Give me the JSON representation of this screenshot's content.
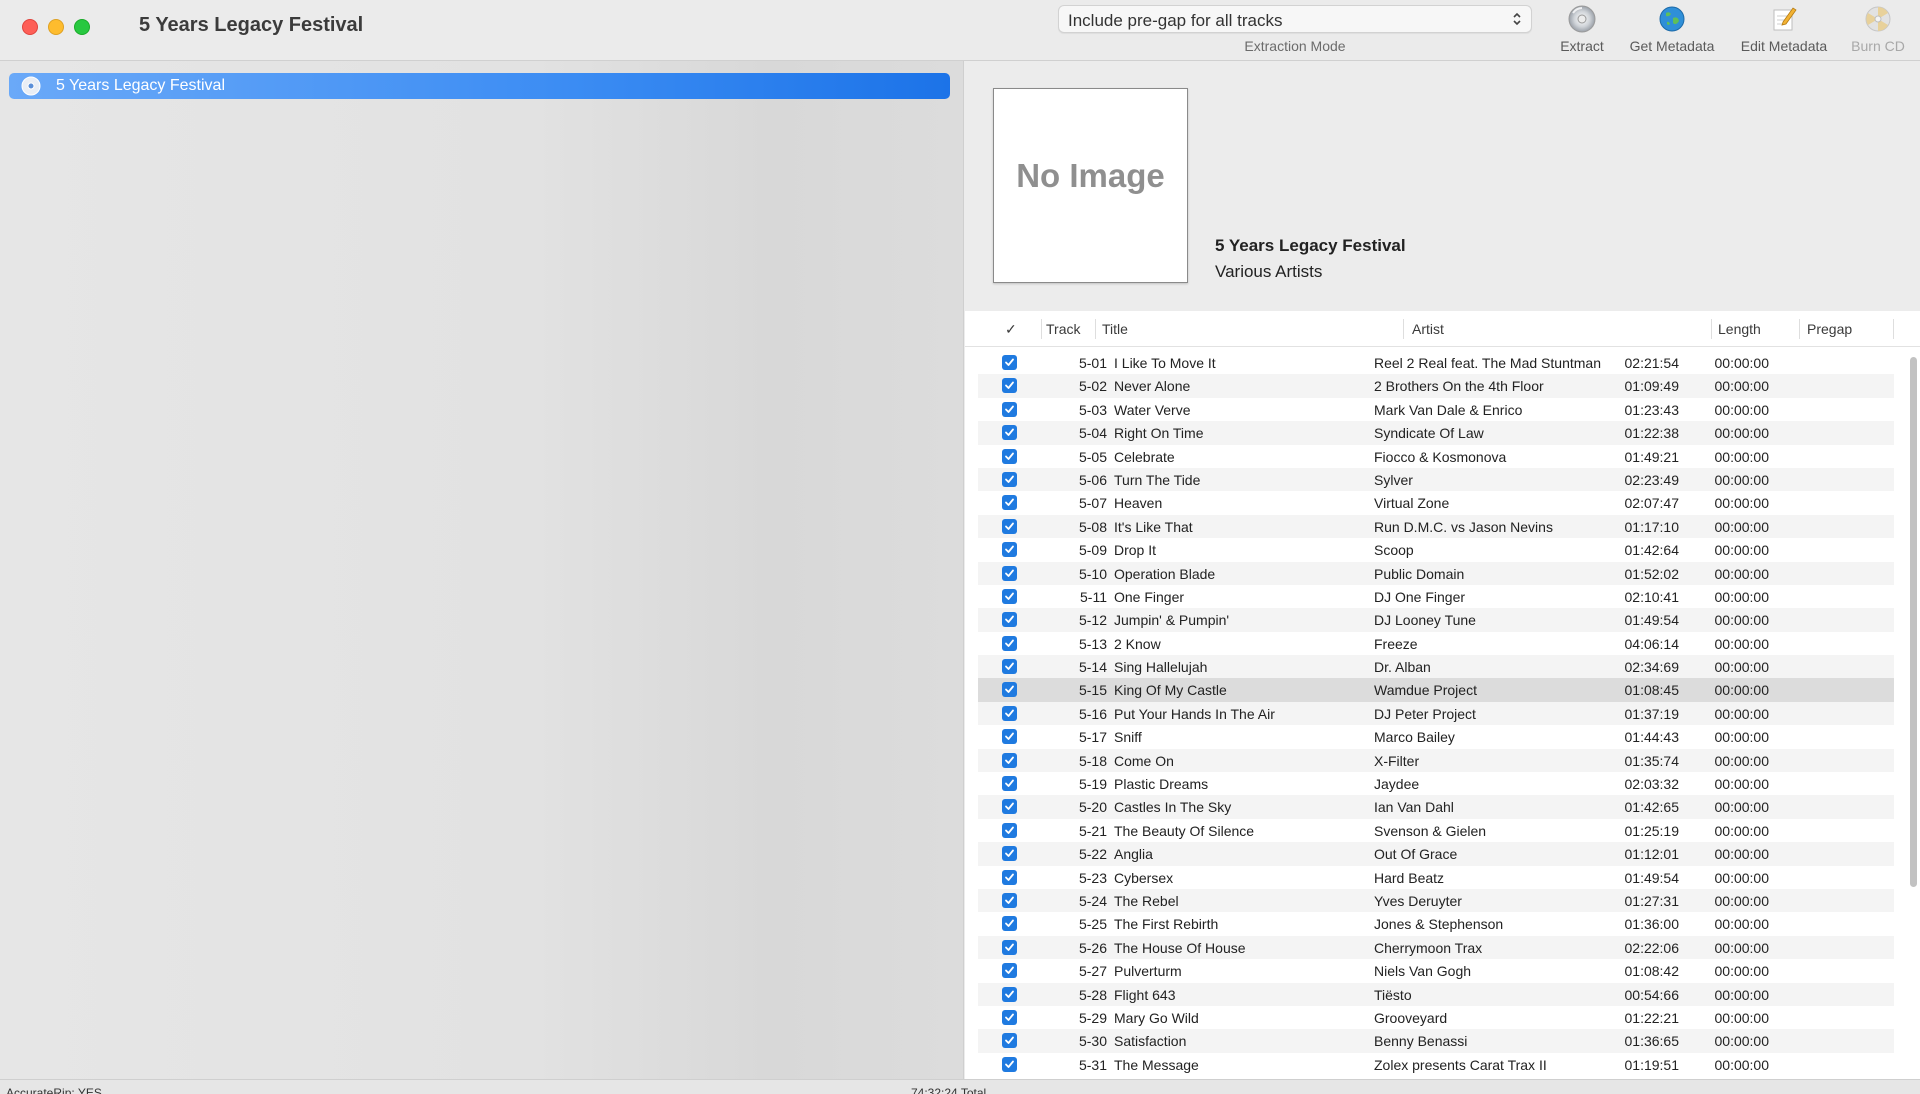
{
  "window": {
    "title": "5 Years Legacy Festival"
  },
  "toolbar": {
    "extraction_mode": {
      "value": "Include pre-gap for all tracks",
      "caption": "Extraction Mode"
    },
    "buttons": [
      {
        "label": "Extract",
        "icon": "cd-icon",
        "enabled": true
      },
      {
        "label": "Get Metadata",
        "icon": "globe-icon",
        "enabled": true
      },
      {
        "label": "Edit Metadata",
        "icon": "pencil-icon",
        "enabled": true
      },
      {
        "label": "Burn CD",
        "icon": "burn-icon",
        "enabled": false
      }
    ]
  },
  "sidebar": {
    "items": [
      {
        "label": "5 Years Legacy Festival",
        "icon": "disc-icon",
        "selected": true
      }
    ]
  },
  "album": {
    "artwork_placeholder": "No Image",
    "title": "5 Years Legacy Festival",
    "artist": "Various Artists"
  },
  "table": {
    "columns": {
      "check": "✓",
      "track": "Track",
      "title": "Title",
      "artist": "Artist",
      "length": "Length",
      "pregap": "Pregap"
    },
    "selected_row": 14,
    "rows": [
      {
        "checked": true,
        "track": "5-01",
        "title": "I Like To Move It",
        "artist": "Reel 2 Real feat. The Mad Stuntman",
        "length": "02:21:54",
        "pregap": "00:00:00"
      },
      {
        "checked": true,
        "track": "5-02",
        "title": "Never Alone",
        "artist": "2 Brothers On the 4th Floor",
        "length": "01:09:49",
        "pregap": "00:00:00"
      },
      {
        "checked": true,
        "track": "5-03",
        "title": "Water Verve",
        "artist": "Mark Van Dale & Enrico",
        "length": "01:23:43",
        "pregap": "00:00:00"
      },
      {
        "checked": true,
        "track": "5-04",
        "title": "Right On Time",
        "artist": "Syndicate Of Law",
        "length": "01:22:38",
        "pregap": "00:00:00"
      },
      {
        "checked": true,
        "track": "5-05",
        "title": "Celebrate",
        "artist": "Fiocco & Kosmonova",
        "length": "01:49:21",
        "pregap": "00:00:00"
      },
      {
        "checked": true,
        "track": "5-06",
        "title": "Turn The Tide",
        "artist": "Sylver",
        "length": "02:23:49",
        "pregap": "00:00:00"
      },
      {
        "checked": true,
        "track": "5-07",
        "title": "Heaven",
        "artist": "Virtual Zone",
        "length": "02:07:47",
        "pregap": "00:00:00"
      },
      {
        "checked": true,
        "track": "5-08",
        "title": "It's Like That",
        "artist": "Run D.M.C. vs Jason Nevins",
        "length": "01:17:10",
        "pregap": "00:00:00"
      },
      {
        "checked": true,
        "track": "5-09",
        "title": "Drop It",
        "artist": "Scoop",
        "length": "01:42:64",
        "pregap": "00:00:00"
      },
      {
        "checked": true,
        "track": "5-10",
        "title": "Operation Blade",
        "artist": "Public Domain",
        "length": "01:52:02",
        "pregap": "00:00:00"
      },
      {
        "checked": true,
        "track": "5-11",
        "title": "One Finger",
        "artist": "DJ One Finger",
        "length": "02:10:41",
        "pregap": "00:00:00"
      },
      {
        "checked": true,
        "track": "5-12",
        "title": "Jumpin' & Pumpin'",
        "artist": "DJ Looney Tune",
        "length": "01:49:54",
        "pregap": "00:00:00"
      },
      {
        "checked": true,
        "track": "5-13",
        "title": "2 Know",
        "artist": "Freeze",
        "length": "04:06:14",
        "pregap": "00:00:00"
      },
      {
        "checked": true,
        "track": "5-14",
        "title": "Sing Hallelujah",
        "artist": "Dr. Alban",
        "length": "02:34:69",
        "pregap": "00:00:00"
      },
      {
        "checked": true,
        "track": "5-15",
        "title": "King Of My Castle",
        "artist": "Wamdue Project",
        "length": "01:08:45",
        "pregap": "00:00:00"
      },
      {
        "checked": true,
        "track": "5-16",
        "title": "Put Your Hands In The Air",
        "artist": "DJ Peter Project",
        "length": "01:37:19",
        "pregap": "00:00:00"
      },
      {
        "checked": true,
        "track": "5-17",
        "title": "Sniff",
        "artist": "Marco Bailey",
        "length": "01:44:43",
        "pregap": "00:00:00"
      },
      {
        "checked": true,
        "track": "5-18",
        "title": "Come On",
        "artist": "X-Filter",
        "length": "01:35:74",
        "pregap": "00:00:00"
      },
      {
        "checked": true,
        "track": "5-19",
        "title": "Plastic Dreams",
        "artist": "Jaydee",
        "length": "02:03:32",
        "pregap": "00:00:00"
      },
      {
        "checked": true,
        "track": "5-20",
        "title": "Castles In The Sky",
        "artist": "Ian Van Dahl",
        "length": "01:42:65",
        "pregap": "00:00:00"
      },
      {
        "checked": true,
        "track": "5-21",
        "title": "The Beauty Of Silence",
        "artist": "Svenson & Gielen",
        "length": "01:25:19",
        "pregap": "00:00:00"
      },
      {
        "checked": true,
        "track": "5-22",
        "title": "Anglia",
        "artist": "Out Of Grace",
        "length": "01:12:01",
        "pregap": "00:00:00"
      },
      {
        "checked": true,
        "track": "5-23",
        "title": "Cybersex",
        "artist": "Hard Beatz",
        "length": "01:49:54",
        "pregap": "00:00:00"
      },
      {
        "checked": true,
        "track": "5-24",
        "title": "The Rebel",
        "artist": "Yves Deruyter",
        "length": "01:27:31",
        "pregap": "00:00:00"
      },
      {
        "checked": true,
        "track": "5-25",
        "title": "The First Rebirth",
        "artist": "Jones & Stephenson",
        "length": "01:36:00",
        "pregap": "00:00:00"
      },
      {
        "checked": true,
        "track": "5-26",
        "title": "The House Of House",
        "artist": "Cherrymoon Trax",
        "length": "02:22:06",
        "pregap": "00:00:00"
      },
      {
        "checked": true,
        "track": "5-27",
        "title": "Pulverturm",
        "artist": "Niels Van Gogh",
        "length": "01:08:42",
        "pregap": "00:00:00"
      },
      {
        "checked": true,
        "track": "5-28",
        "title": "Flight 643",
        "artist": "Tiësto",
        "length": "00:54:66",
        "pregap": "00:00:00"
      },
      {
        "checked": true,
        "track": "5-29",
        "title": "Mary Go Wild",
        "artist": "Grooveyard",
        "length": "01:22:21",
        "pregap": "00:00:00"
      },
      {
        "checked": true,
        "track": "5-30",
        "title": "Satisfaction",
        "artist": "Benny Benassi",
        "length": "01:36:65",
        "pregap": "00:00:00"
      },
      {
        "checked": true,
        "track": "5-31",
        "title": "The Message",
        "artist": "Zolex presents Carat Trax II",
        "length": "01:19:51",
        "pregap": "00:00:00"
      }
    ]
  },
  "status": {
    "accuraterip": "AccurateRip: YES",
    "total": "74:32:24 Total"
  },
  "colors": {
    "accent": "#1f7ae0",
    "selection": "#3b8cf3"
  }
}
